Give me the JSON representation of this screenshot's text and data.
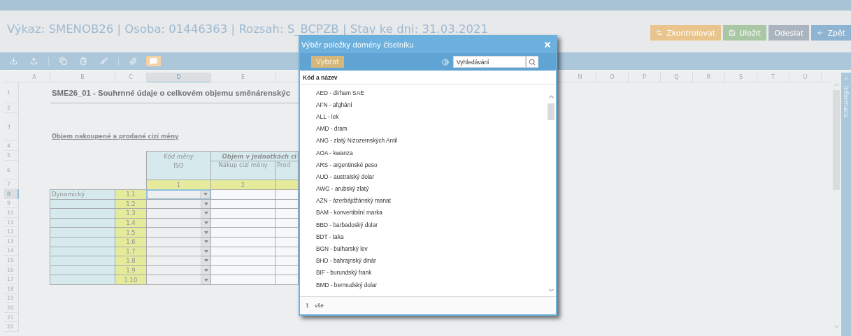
{
  "header": {
    "title": "Výkaz: SMENOB26 | Osoba: 01446363 | Rozsah: S_BCPZB | Stav ke dni: 31.03.2021",
    "buttons": [
      {
        "label": "Zkontrolovat",
        "kind": "check"
      },
      {
        "label": "Uložit",
        "kind": "save"
      },
      {
        "label": "Odeslat",
        "kind": "send"
      },
      {
        "label": "Zpět",
        "kind": "back"
      }
    ]
  },
  "toolbar": {
    "comments_on": true
  },
  "sheet": {
    "columns_left": [
      {
        "label": "A",
        "selected": false
      },
      {
        "label": "B",
        "selected": false
      },
      {
        "label": "C",
        "selected": false
      },
      {
        "label": "D",
        "selected": true
      },
      {
        "label": "E",
        "selected": false
      }
    ],
    "columns_right": [
      {
        "label": "N",
        "selected": false
      },
      {
        "label": "O",
        "selected": false
      },
      {
        "label": "P",
        "selected": false
      },
      {
        "label": "Q",
        "selected": false
      },
      {
        "label": "R",
        "selected": false
      },
      {
        "label": "S",
        "selected": false
      },
      {
        "label": "T",
        "selected": false
      },
      {
        "label": "U",
        "selected": false
      }
    ],
    "rows": [
      {
        "label": "1",
        "selected": false
      },
      {
        "label": "2",
        "selected": false
      },
      {
        "label": "3",
        "selected": false
      },
      {
        "label": "4",
        "selected": false
      },
      {
        "label": "5",
        "selected": false
      },
      {
        "label": "6",
        "selected": false
      },
      {
        "label": "7",
        "selected": false
      },
      {
        "label": "8",
        "selected": true
      },
      {
        "label": "9",
        "selected": false
      },
      {
        "label": "10",
        "selected": false
      },
      {
        "label": "11",
        "selected": false
      },
      {
        "label": "12",
        "selected": false
      },
      {
        "label": "13",
        "selected": false
      },
      {
        "label": "14",
        "selected": false
      },
      {
        "label": "15",
        "selected": false
      },
      {
        "label": "16",
        "selected": false
      },
      {
        "label": "17",
        "selected": false
      },
      {
        "label": "18",
        "selected": false
      },
      {
        "label": "19",
        "selected": false
      },
      {
        "label": "20",
        "selected": false
      },
      {
        "label": "21",
        "selected": false
      },
      {
        "label": "22",
        "selected": false
      }
    ],
    "title": "SME26_01 - Souhrnné údaje o celkovém objemu směnárenskýc",
    "section_label": "Objem nakoupené a prodané cizí měny",
    "table": {
      "code_header": "Kód měny",
      "code_subheader": "ISO",
      "volume_header": "Objem v jednotkách ci",
      "buy_header": "Nákup cizí měny",
      "sell_header": "Prod",
      "column_numbers": [
        "1",
        "2"
      ],
      "lines": [
        {
          "name": "Dynamický",
          "code": "1.1",
          "selected": true
        },
        {
          "code": "1.2",
          "selected": false
        },
        {
          "code": "1.3",
          "selected": false
        },
        {
          "code": "1.4",
          "selected": false
        },
        {
          "code": "1.5",
          "selected": false
        },
        {
          "code": "1.6",
          "selected": false
        },
        {
          "code": "1.7",
          "selected": false
        },
        {
          "code": "1.8",
          "selected": false
        },
        {
          "code": "1.9",
          "selected": false
        },
        {
          "code": "1.10",
          "selected": false
        }
      ]
    }
  },
  "dialog": {
    "title": "Výběr položky domény číselníku",
    "select_button": "Vybrat",
    "search": {
      "placeholder": "Vyhledávání"
    },
    "column_header": "Kód a název",
    "items": [
      "AED - dirham SAE",
      "AFN - afghání",
      "ALL - lek",
      "AMD - dram",
      "ANG - zlatý Nizozemských Antil",
      "AOA - kwanza",
      "ARS - argentinské peso",
      "AUD - australský dolar",
      "AWG - arubský zlatý",
      "AZN - ázerbájdžánský manat",
      "BAM - konvertibilní marka",
      "BBD - barbadoský dolar",
      "BDT - taka",
      "BGN - bulharský lev",
      "BHD - bahrajnský dinár",
      "BIF - burundský frank",
      "BMD - bermudský dolar"
    ],
    "footer": {
      "page": "1",
      "all": "vše"
    }
  },
  "sidebar": {
    "label": "Informace"
  }
}
